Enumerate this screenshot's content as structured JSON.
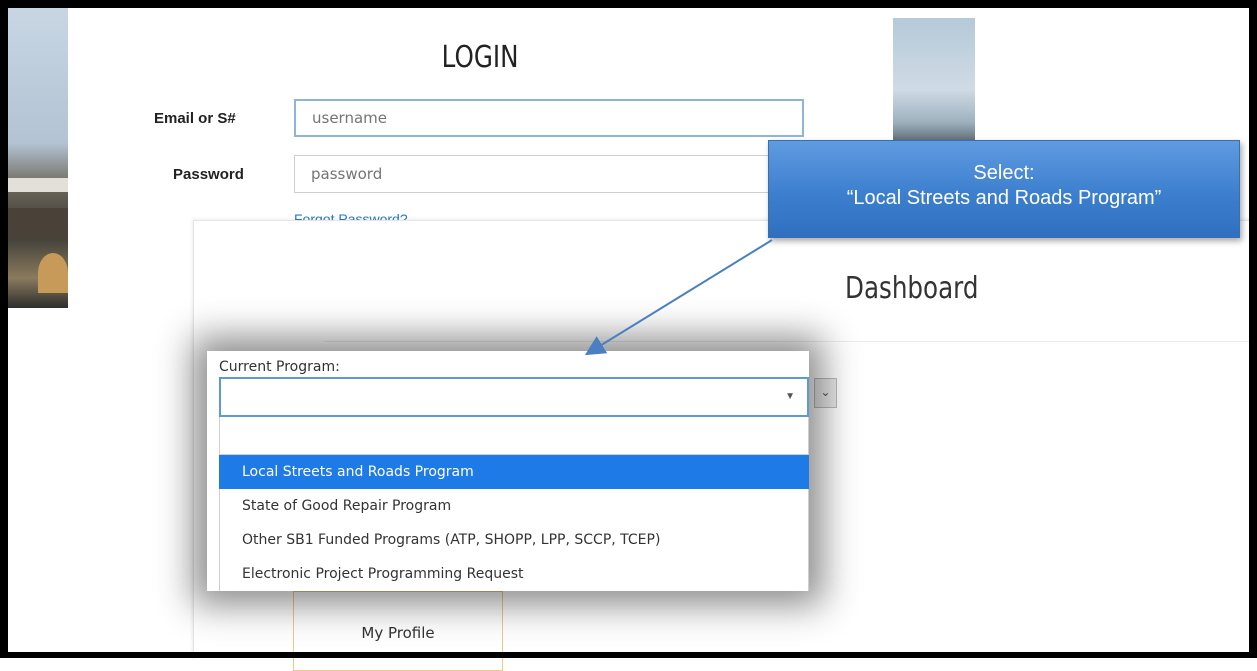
{
  "login": {
    "title": "LOGIN",
    "email_label": "Email or S#",
    "email_placeholder": "username",
    "password_label": "Password",
    "password_placeholder": "password",
    "forgot_link": "Forgot Password?"
  },
  "callout": {
    "line1": "Select:",
    "line2": "“Local Streets and Roads Program”"
  },
  "dashboard": {
    "title": "Dashboard",
    "tile_label": "My Profile"
  },
  "program_select": {
    "label": "Current Program:",
    "value": "",
    "search_value": "",
    "options": [
      {
        "label": "Local Streets and Roads Program",
        "selected": true
      },
      {
        "label": "State of Good Repair Program",
        "selected": false
      },
      {
        "label": "Other SB1 Funded Programs (ATP, SHOPP, LPP, SCCP, TCEP)",
        "selected": false
      },
      {
        "label": "Electronic Project Programming Request",
        "selected": false
      }
    ]
  },
  "colors": {
    "callout": "#3d7fcf",
    "selected_option": "#1e7ae6",
    "select_border": "#5b9bd5",
    "link": "#2a79c7"
  }
}
